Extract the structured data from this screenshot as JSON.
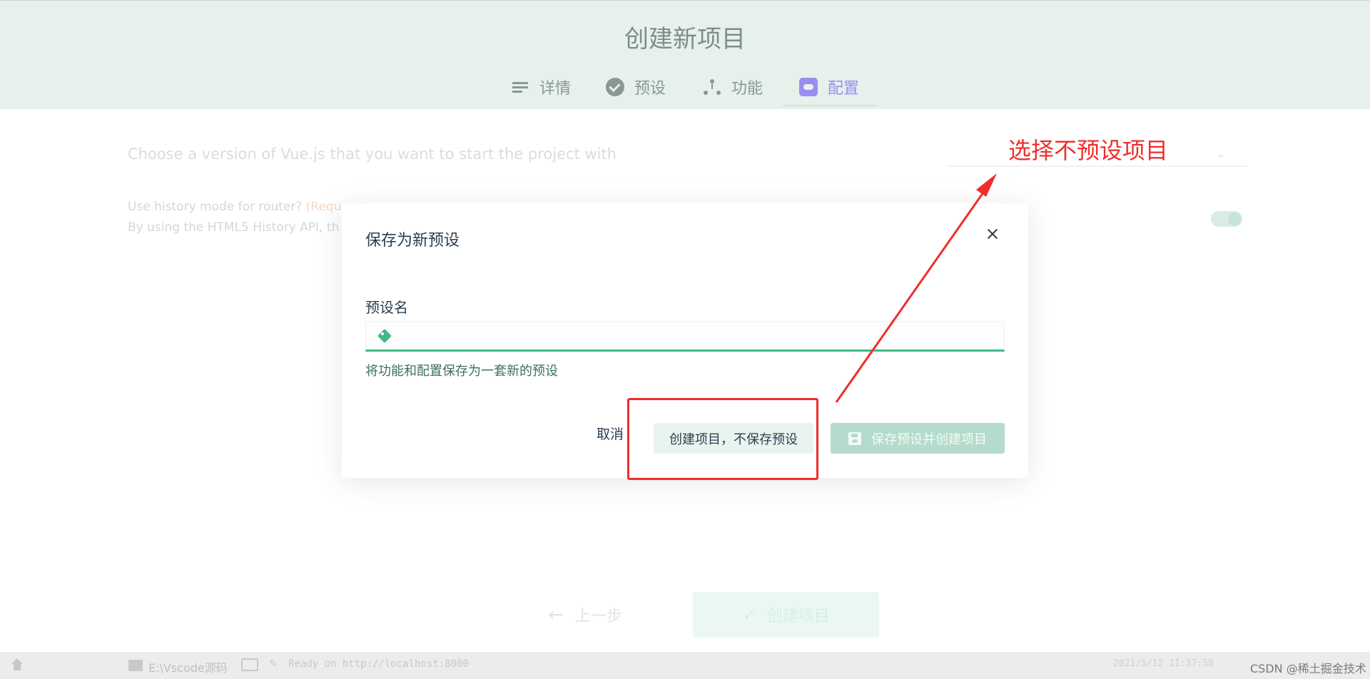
{
  "page": {
    "title": "创建新项目",
    "steps": [
      {
        "label": "详情",
        "icon": "list-icon"
      },
      {
        "label": "预设",
        "icon": "check-circle-icon"
      },
      {
        "label": "功能",
        "icon": "tree-icon"
      },
      {
        "label": "配置",
        "icon": "config-icon",
        "active": true
      }
    ],
    "version_prompt": "Choose a version of Vue.js that you want to start the project with",
    "history_title": "Use history mode for router?",
    "history_required": "(Requ",
    "history_desc": "By using the HTML5 History API, th",
    "prev_button": "上一步",
    "create_button": "创建项目"
  },
  "modal": {
    "title": "保存为新预设",
    "field_label": "预设名",
    "field_value": "",
    "field_help": "将功能和配置保存为一套新的预设",
    "cancel": "取消",
    "create_no_save": "创建项目，不保存预设",
    "save_and_create": "保存预设并创建项目"
  },
  "status_bar": {
    "path": "E:\\Vscode源码",
    "ready": "Ready on http://localhost:8000",
    "time": "2021/5/12 11:37:58",
    "watermark": "CSDN @稀土掘金技术社区"
  },
  "annotation": {
    "text": "选择不预设项目",
    "color": "#f02d2d"
  },
  "colors": {
    "accent": "#42b983",
    "header_bg": "#e6f1ec",
    "save_button": "#b4dbcb"
  }
}
